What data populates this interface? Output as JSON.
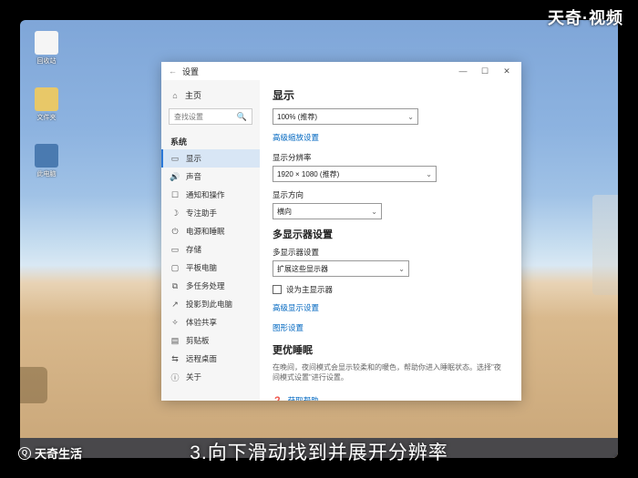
{
  "branding": {
    "top_right": "天奇·视频",
    "bottom_left": "天奇生活"
  },
  "caption": "3.向下滑动找到并展开分辨率",
  "desktop_icons": [
    "回收站",
    "文件夹",
    "此电脑"
  ],
  "window": {
    "title": "设置",
    "controls": {
      "min": "—",
      "max": "☐",
      "close": "✕"
    },
    "home": "主页",
    "search_placeholder": "查找设置",
    "category": "系统",
    "nav": [
      "显示",
      "声音",
      "通知和操作",
      "专注助手",
      "电源和睡眠",
      "存储",
      "平板电脑",
      "多任务处理",
      "投影到此电脑",
      "体验共享",
      "剪贴板",
      "远程桌面",
      "关于"
    ]
  },
  "content": {
    "heading": "显示",
    "scale_value": "100% (推荐)",
    "adv_scale_link": "高级缩放设置",
    "res_label": "显示分辨率",
    "res_value": "1920 × 1080 (推荐)",
    "orient_label": "显示方向",
    "orient_value": "横向",
    "multi_heading": "多显示器设置",
    "multi_label": "多显示器设置",
    "multi_value": "扩展这些显示器",
    "main_chk": "设为主显示器",
    "adv_display_link": "高级显示设置",
    "graphics_link": "图形设置",
    "pref_heading": "更优睡眠",
    "pref_text": "在晚间，夜间模式会显示较柔和的暖色，帮助你进入睡眠状态。选择\"夜间模式设置\"进行设置。",
    "help_link": "获取帮助"
  }
}
